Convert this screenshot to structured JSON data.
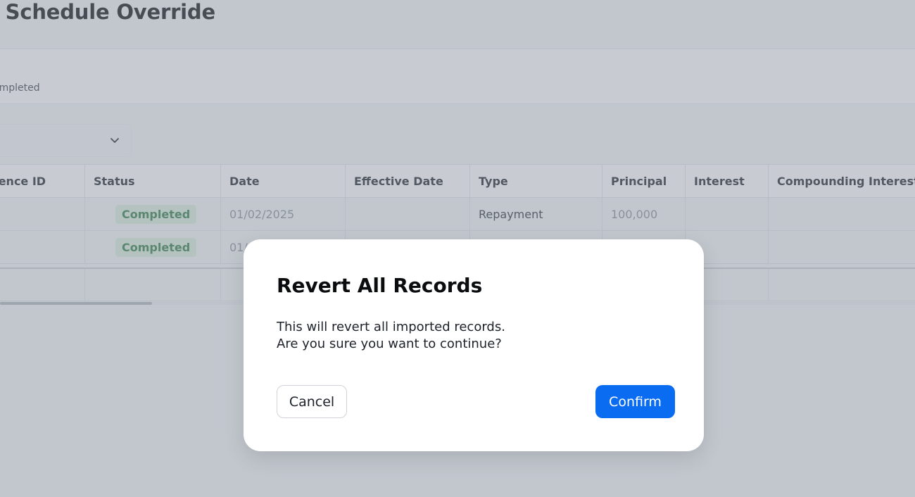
{
  "page": {
    "title": "l Schedule Override"
  },
  "info": {
    "status_text": "ompleted"
  },
  "table": {
    "columns": [
      "ference ID",
      "Status",
      "Date",
      "Effective Date",
      "Type",
      "Principal",
      "Interest",
      "Compounding Interest"
    ],
    "rows": [
      {
        "reference_id": "",
        "status": "Completed",
        "date": "01/02/2025",
        "effective_date": "",
        "type": "Repayment",
        "principal": "100,000",
        "interest": "",
        "compounding_interest": ""
      },
      {
        "reference_id": "",
        "status": "Completed",
        "date": "01/",
        "effective_date": "",
        "type": "",
        "principal": "",
        "interest": "",
        "compounding_interest": ""
      }
    ]
  },
  "modal": {
    "title": "Revert All Records",
    "body_line1": "This will revert all imported records.",
    "body_line2": "Are you sure you want to continue?",
    "cancel_label": "Cancel",
    "confirm_label": "Confirm"
  },
  "colors": {
    "accent": "#0a6cf0",
    "badge_bg": "#d8eedd",
    "badge_text": "#2f7a44"
  },
  "icons": {
    "select_chevron": "chevron-down-icon"
  }
}
